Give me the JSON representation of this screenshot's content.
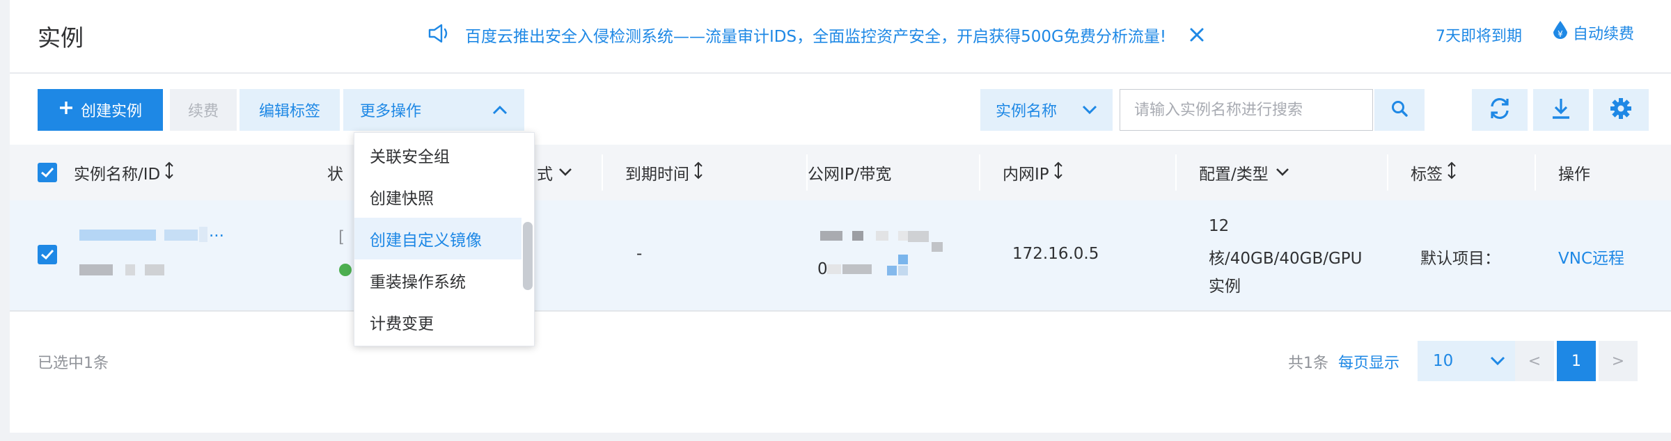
{
  "header": {
    "title": "实例",
    "notice": "百度云推出安全入侵检测系统——流量审计IDS，全面监控资产安全，开启获得500G免费分析流量!",
    "expire_link": "7天即将到期",
    "auto_renew": "自动续费"
  },
  "toolbar": {
    "create": "创建实例",
    "renew": "续费",
    "edit_tags": "编辑标签",
    "more": "更多操作",
    "search_field": "实例名称",
    "search_placeholder": "请输入实例名称进行搜索"
  },
  "dropdown": {
    "items": [
      {
        "label": "关联安全组"
      },
      {
        "label": "创建快照"
      },
      {
        "label": "创建自定义镜像",
        "active": true
      },
      {
        "label": "重装操作系统"
      },
      {
        "label": "计费变更"
      }
    ]
  },
  "table": {
    "columns": {
      "name_id": "实例名称/ID",
      "status": "状",
      "pay_type": "式",
      "expire": "到期时间",
      "public_ip": "公网IP/带宽",
      "private_ip": "内网IP",
      "config": "配置/类型",
      "tags": "标签",
      "actions": "操作"
    },
    "rows": [
      {
        "name_suffix": "...",
        "status_prefix": "[",
        "expire": "-",
        "public_ip_prefix": "0",
        "private_ip": "172.16.0.5",
        "config_line1": "12",
        "config_line2": "核/40GB/40GB/GPU",
        "config_line3": "实例",
        "tags": "默认项目：",
        "action": "VNC远程"
      }
    ]
  },
  "footer": {
    "selected": "已选中1条",
    "total": "共1条",
    "per_page": "每页显示",
    "page_size": "10",
    "prev": "<",
    "current_page": "1",
    "next": ">"
  },
  "colors": {
    "accent": "#1e88e5",
    "status_running": "#4caf50"
  },
  "icons": {
    "notice": "speaker-icon",
    "close": "close-icon",
    "auto_renew": "shield-yen-icon",
    "search": "search-icon",
    "refresh": "refresh-icon",
    "download": "download-icon",
    "settings": "gear-icon"
  }
}
